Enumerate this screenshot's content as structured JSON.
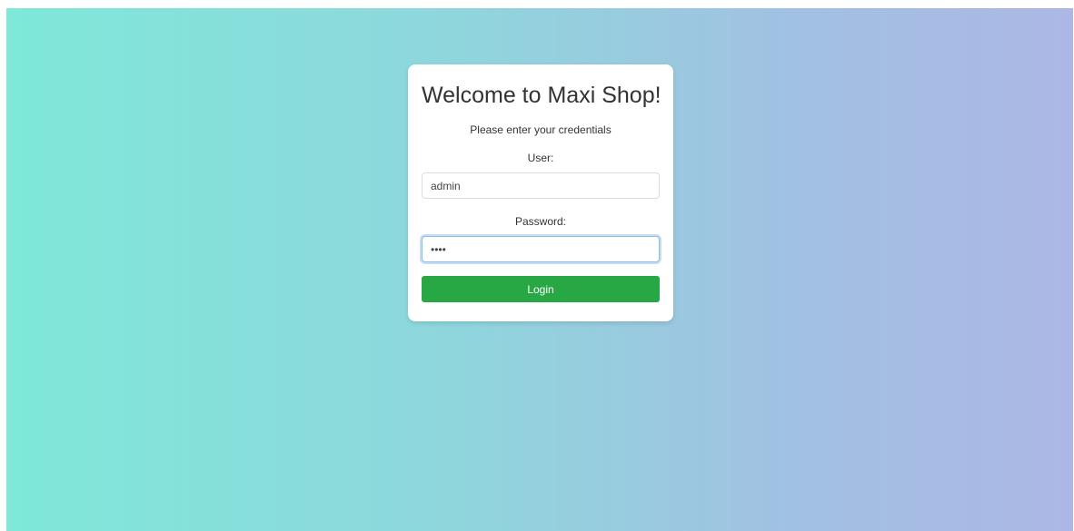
{
  "login": {
    "title": "Welcome to Maxi Shop!",
    "subtitle": "Please enter your credentials",
    "user_label": "User:",
    "user_value": "admin",
    "password_label": "Password:",
    "password_value": "abcd",
    "login_label": "Login"
  },
  "colors": {
    "gradient_left": "#7ee8d9",
    "gradient_right": "#acb7e5",
    "button": "#28a745"
  }
}
